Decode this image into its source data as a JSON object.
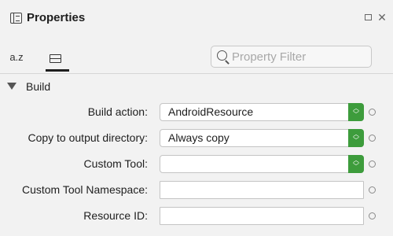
{
  "panel": {
    "title": "Properties"
  },
  "window_controls": {
    "maximize_icon": "maximize-icon",
    "close_symbol": "✕"
  },
  "tabs": [
    {
      "label": "a.z",
      "icon": "sort-alphabetical-icon"
    },
    {
      "label": "",
      "icon": "categorized-icon",
      "selected": true
    }
  ],
  "search": {
    "placeholder": "Property Filter",
    "value": ""
  },
  "group": {
    "label": "Build",
    "expanded": true
  },
  "properties": [
    {
      "label": "Build action:",
      "value": "AndroidResource",
      "type": "dropdown"
    },
    {
      "label": "Copy to output directory:",
      "value": "Always copy",
      "type": "dropdown"
    },
    {
      "label": "Custom Tool:",
      "value": "",
      "type": "dropdown"
    },
    {
      "label": "Custom Tool Namespace:",
      "value": "",
      "type": "text"
    },
    {
      "label": "Resource ID:",
      "value": "",
      "type": "text"
    }
  ],
  "colors": {
    "dropdown_button": "#3d9c3c",
    "background": "#f2f2f2"
  }
}
